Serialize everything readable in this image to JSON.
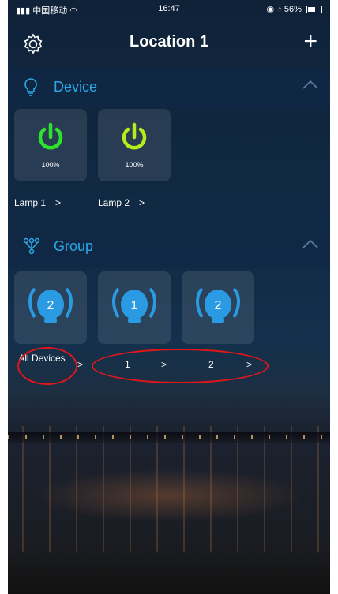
{
  "status": {
    "carrier": "中国移动",
    "time": "16:47",
    "battery": "56%"
  },
  "header": {
    "title": "Location 1"
  },
  "device_section": {
    "label": "Device",
    "items": [
      {
        "name": "Lamp 1",
        "brightness": "100%",
        "color": "#2fe22c"
      },
      {
        "name": "Lamp 2",
        "brightness": "100%",
        "color": "#b6ec1c"
      }
    ]
  },
  "group_section": {
    "label": "Group",
    "items": [
      {
        "name": "All Devices",
        "badge": "2"
      },
      {
        "name": "1",
        "badge": "1"
      },
      {
        "name": "2",
        "badge": "2"
      }
    ]
  },
  "arrow_glyph": ">",
  "colors": {
    "accent": "#2aa9e8",
    "annotation": "#e0161b"
  }
}
